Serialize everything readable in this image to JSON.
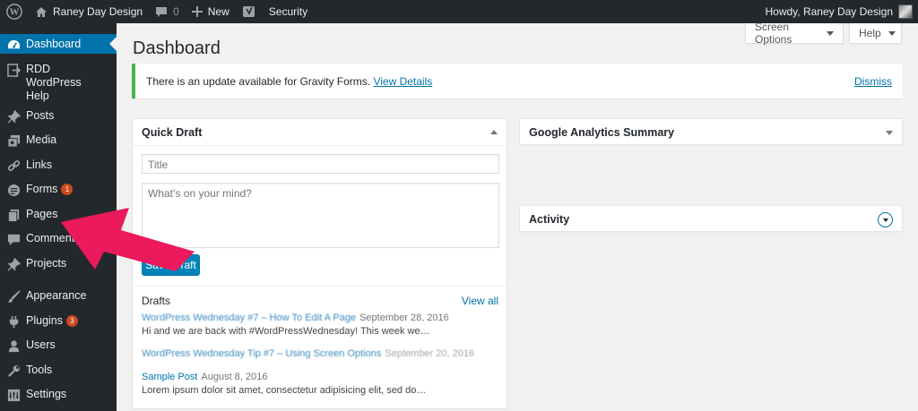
{
  "admin_bar": {
    "site_name": "Raney Day Design",
    "comments_count": "0",
    "new_label": "New",
    "security_label": "Security",
    "howdy": "Howdy, Raney Day Design"
  },
  "sidebar": {
    "items": [
      {
        "label": "Dashboard",
        "icon": "dashboard-icon"
      },
      {
        "label": "RDD WordPress Help",
        "icon": "help-icon"
      },
      {
        "label": "Posts",
        "icon": "pin-icon"
      },
      {
        "label": "Media",
        "icon": "media-icon"
      },
      {
        "label": "Links",
        "icon": "link-icon"
      },
      {
        "label": "Forms",
        "icon": "forms-icon",
        "badge": "1"
      },
      {
        "label": "Pages",
        "icon": "pages-icon"
      },
      {
        "label": "Comments",
        "icon": "comment-icon"
      },
      {
        "label": "Projects",
        "icon": "pin-icon"
      },
      {
        "label": "Appearance",
        "icon": "brush-icon"
      },
      {
        "label": "Plugins",
        "icon": "plug-icon",
        "badge": "3"
      },
      {
        "label": "Users",
        "icon": "user-icon"
      },
      {
        "label": "Tools",
        "icon": "wrench-icon"
      },
      {
        "label": "Settings",
        "icon": "settings-icon"
      }
    ]
  },
  "header": {
    "title": "Dashboard",
    "screen_options": "Screen Options",
    "help": "Help"
  },
  "notice": {
    "text": "There is an update available for Gravity Forms.",
    "link": "View Details",
    "dismiss": "Dismiss"
  },
  "quick_draft": {
    "title": "Quick Draft",
    "title_placeholder": "Title",
    "content_placeholder": "What’s on your mind?",
    "save_label": "Save Draft",
    "drafts_label": "Drafts",
    "view_all": "View all",
    "drafts": [
      {
        "title": "WordPress Wednesday #7 – How To Edit A Page",
        "date": "September 28, 2016",
        "excerpt": "Hi and we are back with #WordPressWednesday!  This week we…"
      },
      {
        "title": "WordPress Wednesday Tip #7 – Using Screen Options",
        "date": "September 20, 2016",
        "excerpt": ""
      },
      {
        "title": "Sample Post",
        "date": "August 8, 2016",
        "excerpt": "Lorem ipsum dolor sit amet, consectetur adipisicing elit, sed do…"
      }
    ]
  },
  "widgets": {
    "analytics_title": "Google Analytics Summary",
    "activity_title": "Activity"
  },
  "colors": {
    "admin_bar_bg": "#23282d",
    "accent": "#0073aa",
    "notice_border": "#46b450",
    "badge": "#ca4a1f",
    "annotation_arrow": "#ea1a5c"
  }
}
